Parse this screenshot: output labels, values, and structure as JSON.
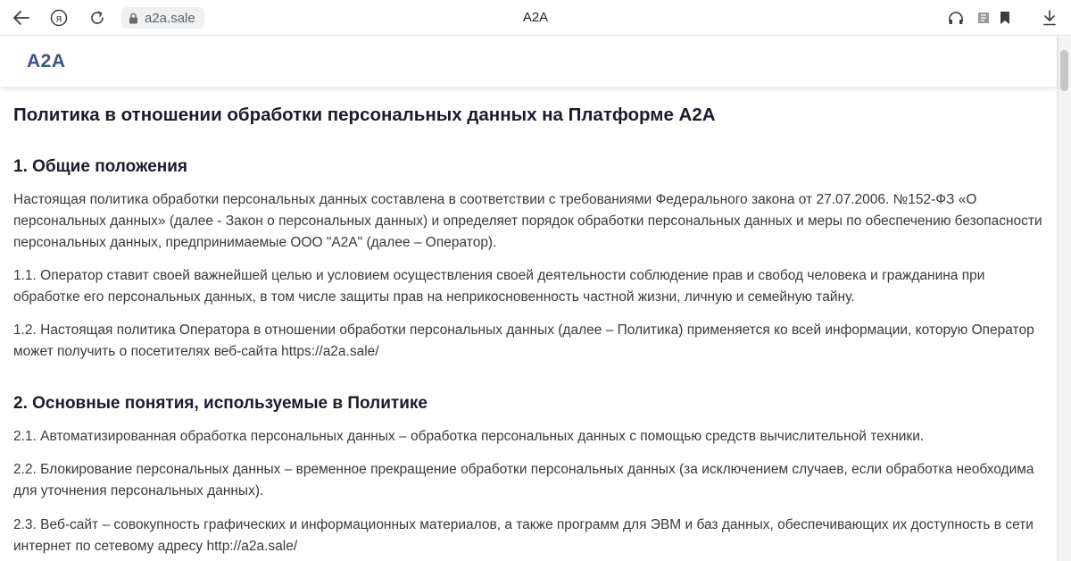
{
  "browser": {
    "tab_title": "A2A",
    "url": "a2a.sale",
    "icons": [
      "back-arrow-icon",
      "yandex-icon",
      "reload-icon",
      "lock-icon",
      "headphones-icon",
      "reader-icon",
      "bookmark-icon",
      "download-icon"
    ]
  },
  "site": {
    "logo": "A2A"
  },
  "doc": {
    "title": "Политика в отношении обработки персональных данных на Платформе А2А",
    "section1": {
      "heading": "1. Общие положения",
      "p0": "Настоящая политика обработки персональных данных составлена в соответствии с требованиями Федерального закона от 27.07.2006. №152-ФЗ «О персональных данных» (далее - Закон о персональных данных) и определяет порядок обработки персональных данных и меры по обеспечению безопасности персональных данных, предпринимаемые ООО \"А2А\" (далее – Оператор).",
      "p1": "1.1. Оператор ставит своей важнейшей целью и условием осуществления своей деятельности соблюдение прав и свобод человека и гражданина при обработке его персональных данных, в том числе защиты прав на неприкосновенность частной жизни, личную и семейную тайну.",
      "p2": "1.2. Настоящая политика Оператора в отношении обработки персональных данных (далее – Политика) применяется ко всей информации, которую Оператор может получить о посетителях веб-сайта https://a2a.sale/"
    },
    "section2": {
      "heading": "2. Основные понятия, используемые в Политике",
      "p1": "2.1. Автоматизированная обработка персональных данных – обработка персональных данных с помощью средств вычислительной техники.",
      "p2": "2.2. Блокирование персональных данных – временное прекращение обработки персональных данных (за исключением случаев, если обработка необходима для уточнения персональных данных).",
      "p3": "2.3. Веб-сайт – совокупность графических и информационных материалов, а также программ для ЭВМ и баз данных, обеспечивающих их доступность в сети интернет по сетевому адресу http://a2a.sale/"
    }
  }
}
